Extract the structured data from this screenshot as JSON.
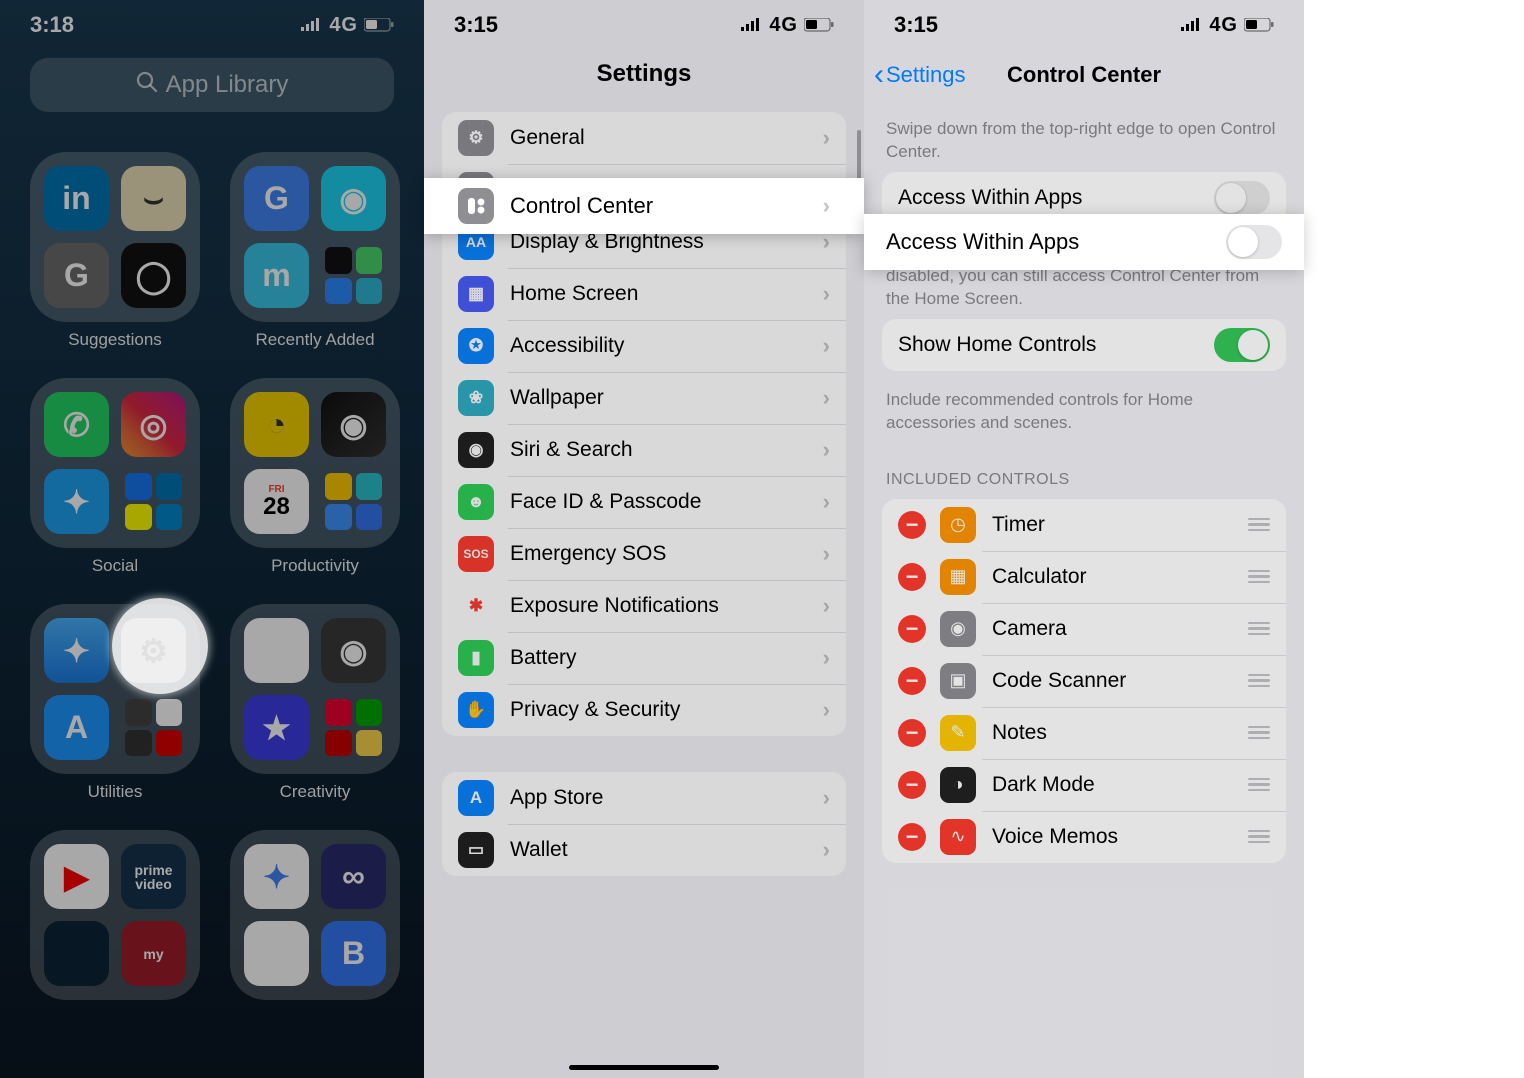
{
  "status": {
    "time1": "3:18",
    "time2": "3:15",
    "time3": "3:15",
    "network": "4G"
  },
  "panel1": {
    "search_placeholder": "App Library",
    "folders": [
      {
        "name": "Suggestions"
      },
      {
        "name": "Recently Added"
      },
      {
        "name": "Social"
      },
      {
        "name": "Productivity"
      },
      {
        "name": "Utilities"
      },
      {
        "name": "Creativity"
      }
    ]
  },
  "panel2": {
    "title": "Settings",
    "items": [
      {
        "label": "General",
        "color": "#8e8e93",
        "glyph": "⚙"
      },
      {
        "label": "Control Center",
        "color": "#8e8e93",
        "glyph": "⊟"
      },
      {
        "label": "Display & Brightness",
        "color": "#0a84ff",
        "glyph": "AA"
      },
      {
        "label": "Home Screen",
        "color": "#4b5efc",
        "glyph": "▦"
      },
      {
        "label": "Accessibility",
        "color": "#0a84ff",
        "glyph": "✪"
      },
      {
        "label": "Wallpaper",
        "color": "#30b0c7",
        "glyph": "❀"
      },
      {
        "label": "Siri & Search",
        "color": "#222222",
        "glyph": "◉"
      },
      {
        "label": "Face ID & Passcode",
        "color": "#30d158",
        "glyph": "☻"
      },
      {
        "label": "Emergency SOS",
        "color": "#ff3b30",
        "glyph": "SOS"
      },
      {
        "label": "Exposure Notifications",
        "color": "#ffffff",
        "glyph": "✱"
      },
      {
        "label": "Battery",
        "color": "#30d158",
        "glyph": "▮"
      },
      {
        "label": "Privacy & Security",
        "color": "#0a84ff",
        "glyph": "✋"
      }
    ],
    "items2": [
      {
        "label": "App Store",
        "color": "#0a84ff",
        "glyph": "A"
      },
      {
        "label": "Wallet",
        "color": "#222222",
        "glyph": "▭"
      }
    ]
  },
  "panel3": {
    "back": "Settings",
    "title": "Control Center",
    "caption1": "Swipe down from the top-right edge to open Control Center.",
    "toggle1": {
      "label": "Access Within Apps",
      "on": false
    },
    "caption2": "Allow access to Control Center within apps. When disabled, you can still access Control Center from the Home Screen.",
    "toggle2": {
      "label": "Show Home Controls",
      "on": true
    },
    "caption3": "Include recommended controls for Home accessories and scenes.",
    "included_header": "Included Controls",
    "included": [
      {
        "label": "Timer",
        "color": "#ff9500",
        "glyph": "◷"
      },
      {
        "label": "Calculator",
        "color": "#ff9500",
        "glyph": "▦"
      },
      {
        "label": "Camera",
        "color": "#8e8e93",
        "glyph": "◉"
      },
      {
        "label": "Code Scanner",
        "color": "#8e8e93",
        "glyph": "▣"
      },
      {
        "label": "Notes",
        "color": "#ffcc00",
        "glyph": "✎"
      },
      {
        "label": "Dark Mode",
        "color": "#222222",
        "glyph": "◑"
      },
      {
        "label": "Voice Memos",
        "color": "#ff3b30",
        "glyph": "∿"
      }
    ]
  }
}
